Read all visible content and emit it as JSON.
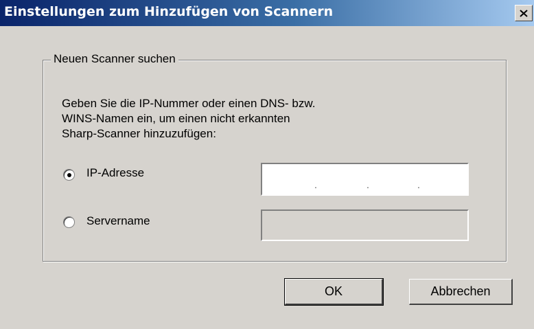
{
  "window": {
    "title": "Einstellungen zum Hinzufügen von Scannern"
  },
  "group": {
    "legend": "Neuen Scanner suchen",
    "description_lines": [
      "Geben Sie die IP-Nummer oder einen DNS- bzw.",
      "WINS-Namen ein, um einen nicht erkannten",
      "Sharp-Scanner hinzuzufügen:"
    ]
  },
  "options": {
    "ip": {
      "label": "IP-Adresse",
      "selected": true,
      "value_separators": [
        ".",
        ".",
        "."
      ]
    },
    "server": {
      "label": "Servername",
      "selected": false,
      "value": ""
    }
  },
  "buttons": {
    "ok": "OK",
    "cancel": "Abbrechen"
  },
  "icons": {
    "close": "close-icon"
  }
}
